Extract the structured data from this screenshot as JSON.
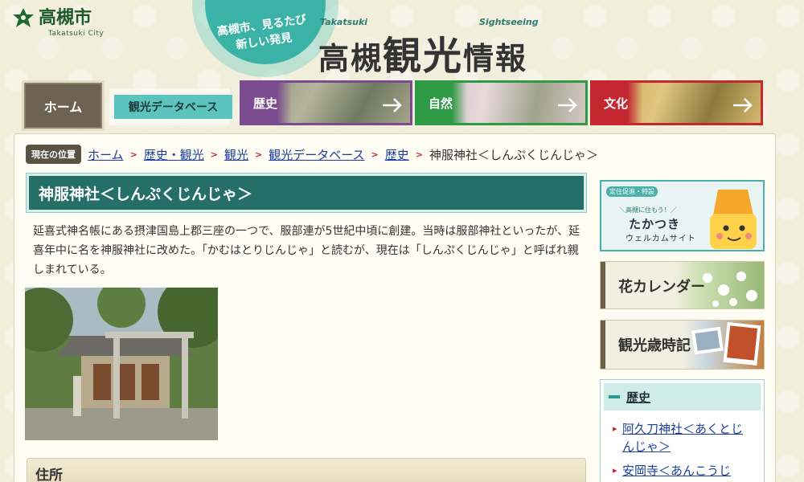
{
  "header": {
    "city_name": "高槻市",
    "city_name_en": "Takatsuki City",
    "catch_line1": "高槻市、見るたび",
    "catch_line2": "新しい発見",
    "title_en_left": "Takatsuki",
    "title_en_right": "Sightseeing",
    "title_part1": "高槻",
    "title_part2": "観光",
    "title_part3": "情報"
  },
  "nav": {
    "home": "ホーム",
    "database": "観光データベース",
    "history": "歴史",
    "nature": "自然",
    "culture": "文化"
  },
  "breadcrumb": {
    "label": "現在の位置",
    "items": [
      "ホーム",
      "歴史・観光",
      "観光",
      "観光データベース",
      "歴史"
    ],
    "current": "神服神社＜しんぷくじんじゃ＞"
  },
  "page": {
    "title": "神服神社＜しんぷくじんじゃ＞",
    "intro": "延喜式神名帳にある摂津国島上郡三座の一つで、服部連が5世紀中頃に創建。当時は服部神社といったが、延喜年中に名を神服神社に改めた。「かむはとりじんじゃ」と読むが、現在は「しんぷくじんじゃ」と呼ばれ親しまれている。",
    "section_address": "住所"
  },
  "sidebar": {
    "welcome_tag": "定住促進・特設",
    "welcome_line1": "＼高槻に住もう！／",
    "welcome_line2": "たかつき",
    "welcome_line3": "ウェルカムサイト",
    "flower_calendar": "花カレンダー",
    "season_calendar": "観光歳時記",
    "history_head": "歴史",
    "history_items": [
      "阿久刀神社＜あくとじんじゃ＞",
      "安岡寺＜あんこうじ"
    ]
  },
  "colors": {
    "title_bar": "#256f68",
    "history": "#7a4b8f",
    "nature": "#2f9a45",
    "culture": "#c3272f",
    "link": "#1a3e9c"
  }
}
